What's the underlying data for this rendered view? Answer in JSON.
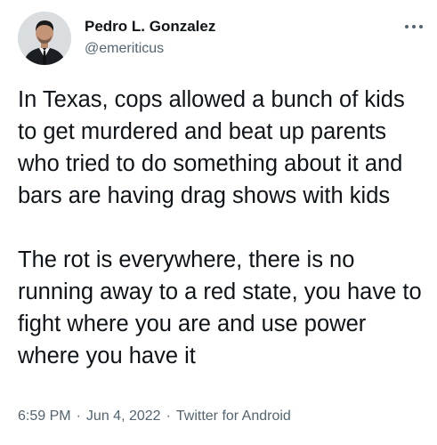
{
  "author": {
    "display_name": "Pedro L. Gonzalez",
    "handle": "@emeriticus",
    "avatar_icon": "profile-photo"
  },
  "more_icon": "more-horizontal-icon",
  "tweet": {
    "paragraphs": [
      "In Texas, cops allowed a bunch of kids to get murdered and beat up parents who tried to do something about it and bars are having drag shows with kids",
      "The rot is everywhere, there is no running away to a red state, you have to fight where you are and use power where you have it"
    ]
  },
  "meta": {
    "time": "6:59 PM",
    "separator": "·",
    "date": "Jun 4, 2022",
    "source": "Twitter for Android"
  },
  "colors": {
    "text": "#0f1419",
    "secondary": "#536471",
    "background": "#ffffff"
  }
}
